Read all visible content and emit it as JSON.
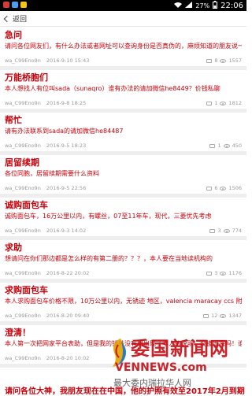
{
  "status_bar": {
    "battery": "27%",
    "time": "22:06",
    "colors": [
      "#d63a3a",
      "#4a9ff5",
      "#f4c21a"
    ]
  },
  "header": {
    "back_label": "返回"
  },
  "posts": [
    {
      "title": "急问",
      "body": "请问各位网友们，有什么办法或者网址可以查询身份是否真伪的，麻烦知道的朋友说一声",
      "author": "wa_C99Eno9n",
      "time": "2016-9-10 15:43",
      "comments": "8",
      "views": "1557"
    },
    {
      "title": "万能桥胞们",
      "body": "本人想找人有位叫sada（sunaqro）谁有办法的请加微信he8449？价钱私聊",
      "author": "wa_C99Eno9n",
      "time": "2016-9-8 18:25",
      "comments": "1",
      "views": "1812"
    },
    {
      "title": "帮忙",
      "body": "请有办法联系到sada的请加微信he84487",
      "author": "wa_C99Eno9n",
      "time": "2016-9-5 18:23",
      "comments": "1",
      "views": "450"
    },
    {
      "title": "居留续期",
      "body": "各位同胞，居留续期需要什么资料",
      "author": "wa_C99Eno9n",
      "time": "2016-9-5 22:56",
      "comments": "6",
      "views": "1506"
    },
    {
      "title": "诚购面包车",
      "body": "诚购面包车，16万公里以内，有螺丝，07至11年车，现代，三菱优先考虑",
      "author": "wa_C99Eno9n",
      "time": "2016-9-3 14:02",
      "comments": "3",
      "views": "774"
    },
    {
      "title": "求助",
      "body": "想请问在你们那边都是怎么样的有第二册的？？？，本人要在当地读机构的",
      "author": "wa_C99Eno9n",
      "time": "2016-8-22 20:02",
      "comments": "3",
      "views": "1176"
    },
    {
      "title": "求购面包车",
      "body": "本人求购面包车价格不限，10万公里以内，无锈迹 地区，valencia maracay ccs 附近，",
      "author": "wa_C99Eno9n",
      "time": "2016-8-20 09:40",
      "comments": "12",
      "views": "1347"
    },
    {
      "title": "澄清！",
      "body": "本人第一次把网家平台表助，但是我的钱并没有用出现了本人的说明，现拔出来吗！谁第一次在此说明白说清楚",
      "author": "wa_C99Eno9n",
      "time": "2016-8-20 10:02",
      "comments": "",
      "views": ""
    }
  ],
  "partial_next_title": "请问各位大神，我朋友现在在中国，他的护照有效至2017年2月到期",
  "watermark": {
    "cn": "委国新闻网",
    "en": "VENNEWS.com",
    "slogan": "最大委内瑞拉华人网"
  }
}
